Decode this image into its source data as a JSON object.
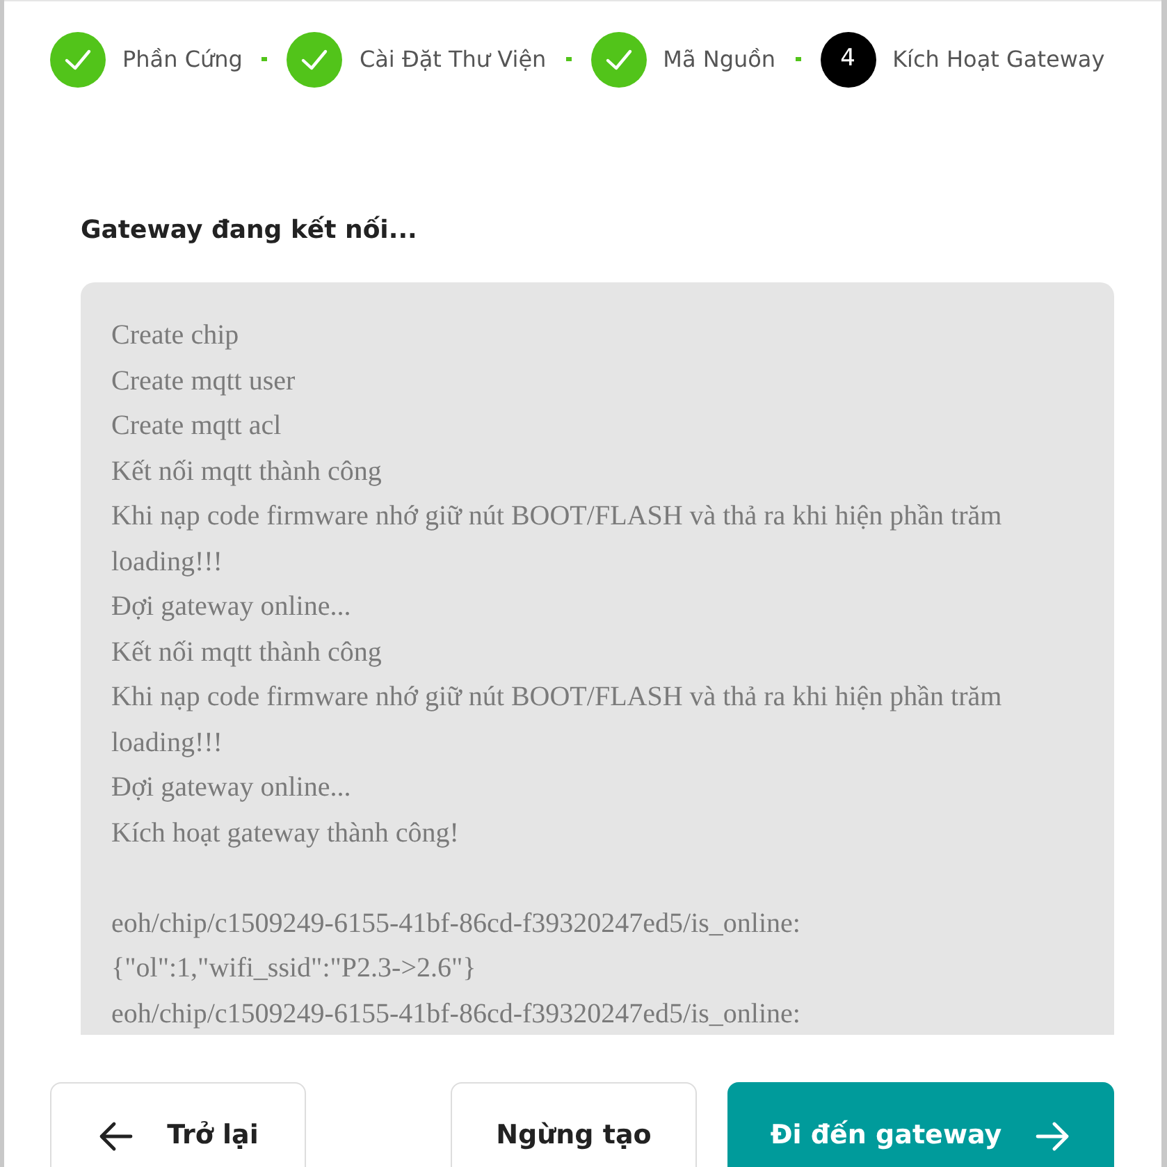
{
  "steps": [
    {
      "label": "Phần Cứng",
      "done": true
    },
    {
      "label": "Cài Đặt Thư Viện",
      "done": true
    },
    {
      "label": "Mã Nguồn",
      "done": true
    },
    {
      "number": "4",
      "label": "Kích Hoạt Gateway",
      "done": false
    }
  ],
  "title": "Gateway đang kết nối...",
  "log_blocks": [
    {
      "lines": [
        "Create chip",
        "Create mqtt user",
        "Create mqtt acl",
        "Kết nối mqtt thành công",
        "Khi nạp code firmware nhớ giữ nút BOOT/FLASH và thả ra khi hiện phần trăm loading!!!",
        "Đợi gateway online...",
        "Kết nối mqtt thành công",
        "Khi nạp code firmware nhớ giữ nút BOOT/FLASH và thả ra khi hiện phần trăm loading!!!",
        "Đợi gateway online...",
        "Kích hoạt gateway thành công!"
      ]
    },
    {
      "lines": [
        "eoh/chip/c1509249-6155-41bf-86cd-f39320247ed5/is_online:",
        "{\"ol\":1,\"wifi_ssid\":\"P2.3->2.6\"}",
        "eoh/chip/c1509249-6155-41bf-86cd-f39320247ed5/is_online:"
      ]
    }
  ],
  "buttons": [
    {
      "kind": "back",
      "label": "Trở lại"
    },
    {
      "kind": "plain",
      "label": "Ngừng tạo"
    },
    {
      "kind": "primary",
      "label": "Đi đến gateway"
    }
  ]
}
